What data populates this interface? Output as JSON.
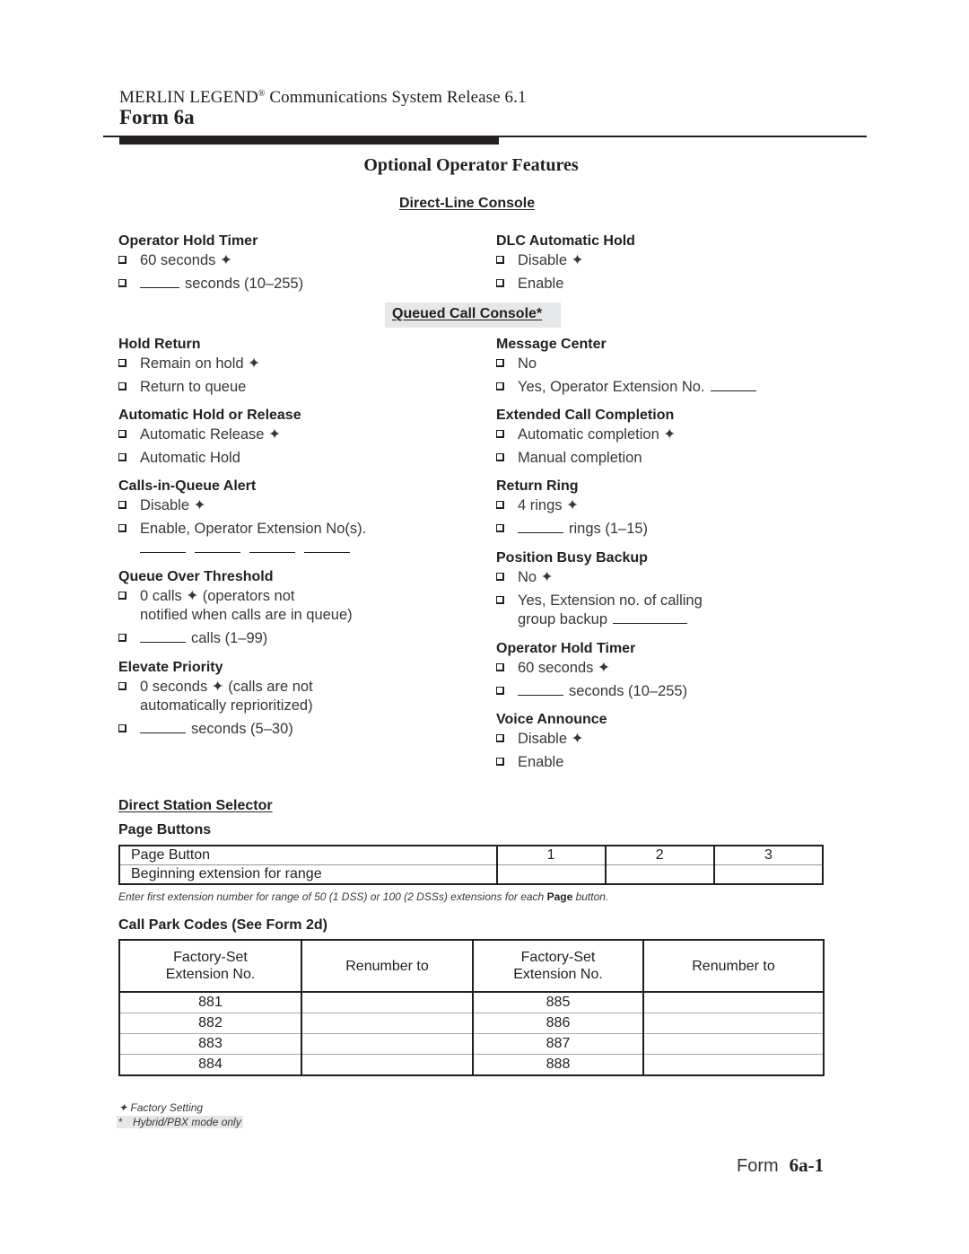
{
  "header": {
    "product": "MERLIN LEGEND",
    "registered_mark": "®",
    "subtitle": " Communications System Release 6.1",
    "form": "Form 6a"
  },
  "page_title": "Optional Operator Features",
  "sections": {
    "direct_line_console": "Direct-Line Console",
    "queued_call_console": "Queued Call Console*",
    "direct_station_selector": "Direct Station Selector"
  },
  "factory_mark": "✦",
  "dlc": {
    "operator_hold_timer": {
      "label": "Operator Hold Timer",
      "options": [
        "60 seconds ✦",
        "seconds (10–255)"
      ]
    },
    "dlc_automatic_hold": {
      "label": "DLC Automatic Hold",
      "options": [
        "Disable ✦",
        "Enable"
      ]
    }
  },
  "qcc_left": {
    "hold_return": {
      "label": "Hold Return",
      "options": [
        "Remain on hold ✦",
        "Return to queue"
      ]
    },
    "automatic_hold_or_release": {
      "label": "Automatic Hold or Release",
      "options": [
        "Automatic Release ✦",
        "Automatic Hold"
      ]
    },
    "calls_in_queue_alert": {
      "label": "Calls-in-Queue Alert",
      "options": [
        "Disable ✦",
        "Enable, Operator Extension No(s)."
      ]
    },
    "queue_over_threshold": {
      "label": "Queue Over Threshold",
      "options": [
        "0 calls ✦ (operators not",
        "notified when calls are in queue)",
        "calls (1–99)"
      ]
    },
    "elevate_priority": {
      "label": "Elevate Priority",
      "options": [
        "0 seconds ✦ (calls are not",
        "automatically reprioritized)",
        "seconds (5–30)"
      ]
    }
  },
  "qcc_right": {
    "message_center": {
      "label": "Message Center",
      "options": [
        "No",
        "Yes, Operator Extension No."
      ]
    },
    "extended_call_completion": {
      "label": "Extended Call Completion",
      "options": [
        "Automatic completion ✦",
        "Manual completion"
      ]
    },
    "return_ring": {
      "label": "Return Ring",
      "options": [
        "4 rings ✦",
        "rings (1–15)"
      ]
    },
    "position_busy_backup": {
      "label": "Position Busy Backup",
      "options": [
        "No ✦",
        "Yes, Extension no. of calling",
        "group backup"
      ]
    },
    "operator_hold_timer": {
      "label": "Operator Hold Timer",
      "options": [
        "60 seconds ✦",
        "seconds (10–255)"
      ]
    },
    "voice_announce": {
      "label": "Voice Announce",
      "options": [
        "Disable ✦",
        "Enable"
      ]
    }
  },
  "page_buttons": {
    "title": "Page Buttons",
    "rows": [
      [
        "Page Button",
        "1",
        "2",
        "3"
      ],
      [
        "Beginning extension for range",
        "",
        "",
        ""
      ]
    ],
    "note_prefix": "Enter first extension number for range of 50 (1 DSS) or 100 (2 DSSs) extensions for each ",
    "note_bold": "Page",
    "note_suffix": " button."
  },
  "call_park": {
    "title": "Call Park Codes (See Form 2d)",
    "headers": [
      [
        "Factory-Set",
        "Extension No."
      ],
      [
        "Renumber to"
      ],
      [
        "Factory-Set",
        "Extension No."
      ],
      [
        "Renumber to"
      ]
    ],
    "rows": [
      [
        "881",
        "",
        "885",
        ""
      ],
      [
        "882",
        "",
        "886",
        ""
      ],
      [
        "883",
        "",
        "887",
        ""
      ],
      [
        "884",
        "",
        "888",
        ""
      ]
    ]
  },
  "legend": {
    "factory_setting": "✦ Factory Setting",
    "asterisk": "*",
    "hybrid": "Hybrid/PBX mode only"
  },
  "footer": {
    "form_label": "Form",
    "page_number": "6a-1"
  }
}
